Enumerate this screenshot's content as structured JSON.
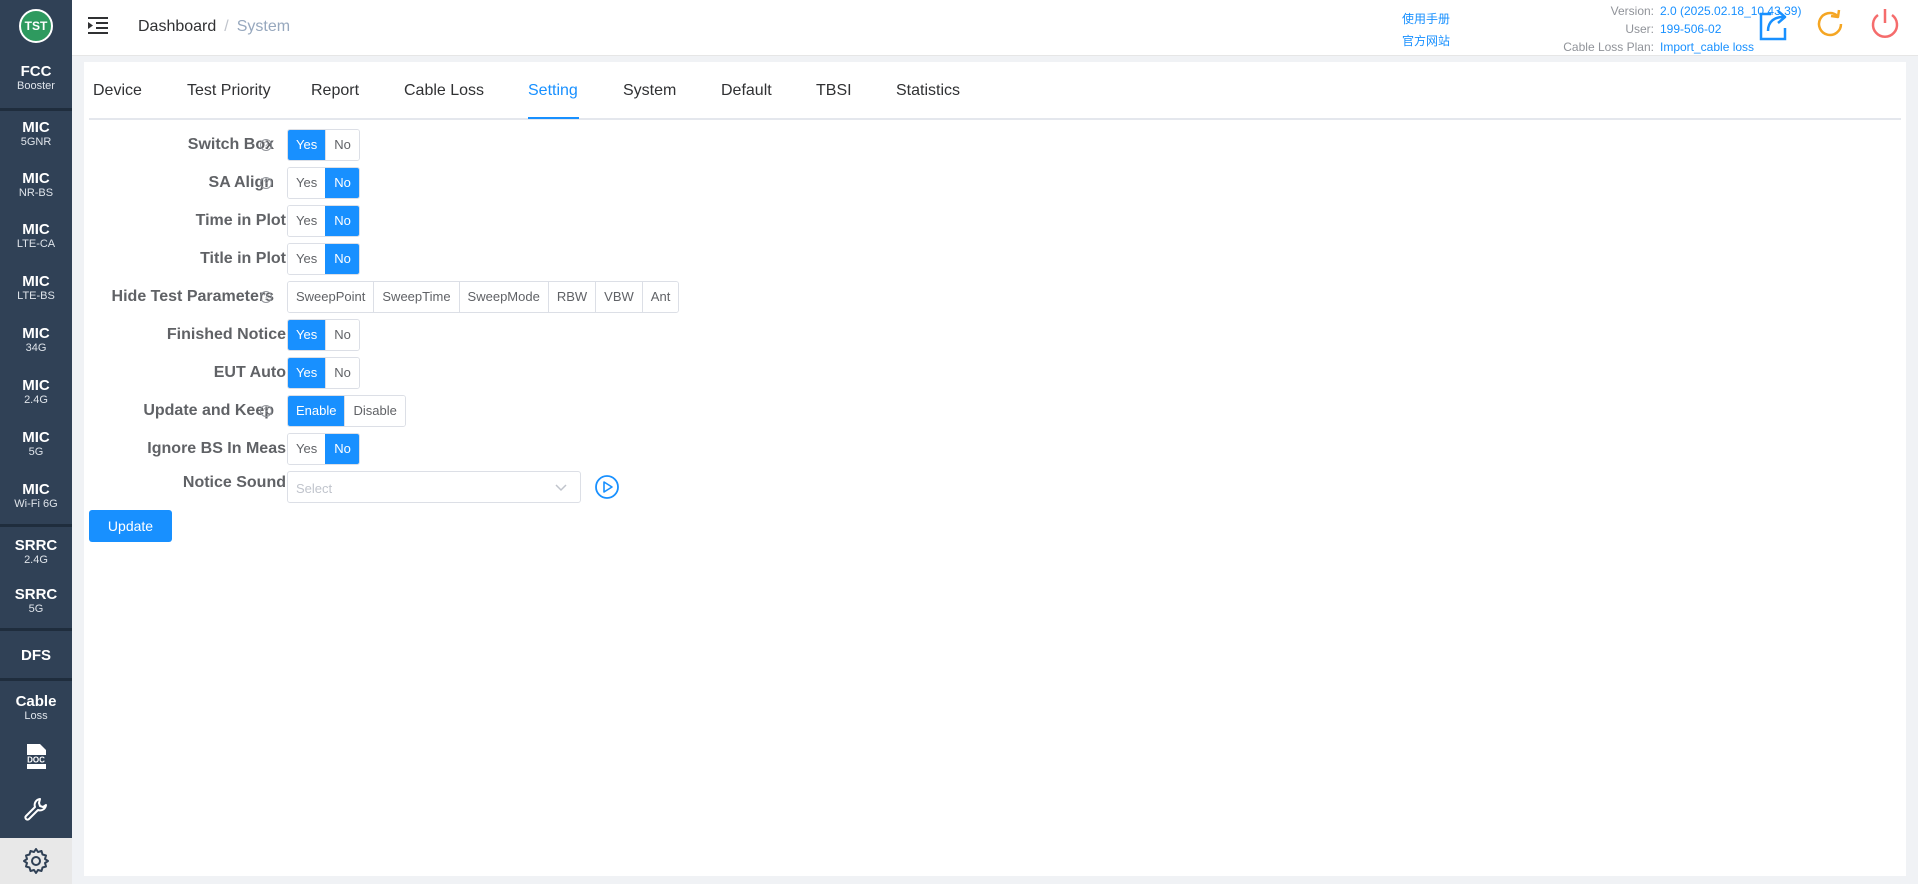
{
  "sidebar": {
    "logo": "TST",
    "items": [
      {
        "line1": "FCC",
        "line2": "Booster"
      },
      {
        "line1": "MIC",
        "line2": "5GNR"
      },
      {
        "line1": "MIC",
        "line2": "NR-BS"
      },
      {
        "line1": "MIC",
        "line2": "LTE-CA"
      },
      {
        "line1": "MIC",
        "line2": "LTE-BS"
      },
      {
        "line1": "MIC",
        "line2": "34G"
      },
      {
        "line1": "MIC",
        "line2": "2.4G"
      },
      {
        "line1": "MIC",
        "line2": "5G"
      },
      {
        "line1": "MIC",
        "line2": "Wi-Fi 6G"
      },
      {
        "line1": "SRRC",
        "line2": "2.4G"
      },
      {
        "line1": "SRRC",
        "line2": "5G"
      },
      {
        "line1": "DFS",
        "line2": ""
      },
      {
        "line1": "Cable",
        "line2": "Loss"
      }
    ],
    "doc_icon_label": "DOC"
  },
  "header": {
    "breadcrumb": [
      "Dashboard",
      "System"
    ],
    "links": [
      "使用手册",
      "官方网站"
    ],
    "info": [
      {
        "key": "Version:",
        "value": "2.0 (2025.02.18_10.43.39)"
      },
      {
        "key": "User:",
        "value": "199-506-02"
      },
      {
        "key": "Cable Loss Plan:",
        "value": "Import_cable loss"
      }
    ]
  },
  "tabs": [
    {
      "label": "Device"
    },
    {
      "label": "Test Priority"
    },
    {
      "label": "Report"
    },
    {
      "label": "Cable Loss"
    },
    {
      "label": "Setting",
      "active": true
    },
    {
      "label": "System"
    },
    {
      "label": "Default"
    },
    {
      "label": "TBSI"
    },
    {
      "label": "Statistics"
    }
  ],
  "form": {
    "switch_box": {
      "label": "Switch Box",
      "options": [
        "Yes",
        "No"
      ],
      "selected": "Yes"
    },
    "sa_align": {
      "label": "SA Align",
      "options": [
        "Yes",
        "No"
      ],
      "selected": "No"
    },
    "time_in_plot": {
      "label": "Time in Plot",
      "options": [
        "Yes",
        "No"
      ],
      "selected": "No"
    },
    "title_in_plot": {
      "label": "Title in Plot",
      "options": [
        "Yes",
        "No"
      ],
      "selected": "No"
    },
    "hide_test_params": {
      "label": "Hide Test Parameters",
      "options": [
        "SweepPoint",
        "SweepTime",
        "SweepMode",
        "RBW",
        "VBW",
        "Ant"
      ]
    },
    "finished_notice": {
      "label": "Finished Notice",
      "options": [
        "Yes",
        "No"
      ],
      "selected": "Yes"
    },
    "eut_auto": {
      "label": "EUT Auto",
      "options": [
        "Yes",
        "No"
      ],
      "selected": "Yes"
    },
    "update_and_keep": {
      "label": "Update and Keep",
      "options": [
        "Enable",
        "Disable"
      ],
      "selected": "Enable"
    },
    "ignore_bs": {
      "label": "Ignore BS In Meas",
      "options": [
        "Yes",
        "No"
      ],
      "selected": "No"
    },
    "notice_sound": {
      "label": "Notice Sound",
      "placeholder": "Select"
    },
    "update_button": "Update"
  },
  "colors": {
    "primary": "#1890ff",
    "sidebar": "#304156",
    "help_icon": "?"
  }
}
